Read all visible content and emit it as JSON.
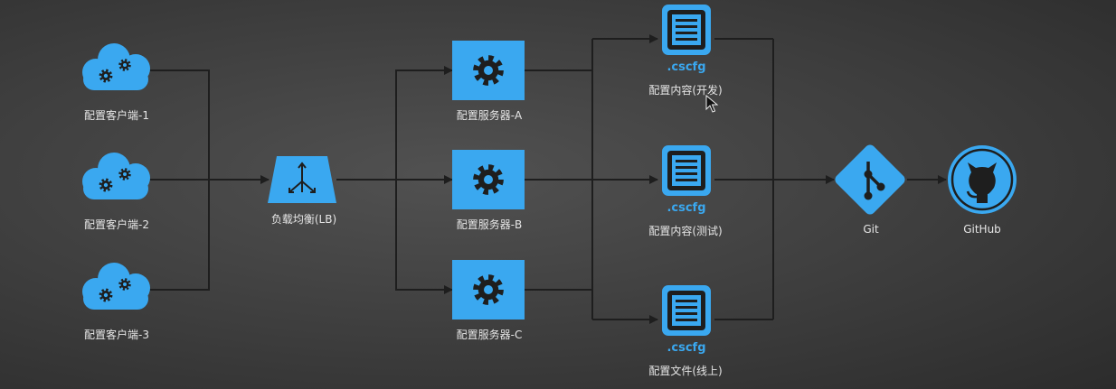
{
  "colors": {
    "accent": "#3aa8f0",
    "line": "#1e1e1e",
    "text": "#e6e6e6"
  },
  "clients": [
    {
      "label": "配置客户端-1",
      "icon": "cloud-gears-icon"
    },
    {
      "label": "配置客户端-2",
      "icon": "cloud-gears-icon"
    },
    {
      "label": "配置客户端-3",
      "icon": "cloud-gears-icon"
    }
  ],
  "load_balancer": {
    "label": "负载均衡(LB)",
    "icon": "load-balancer-icon"
  },
  "servers": [
    {
      "label": "配置服务器-A",
      "icon": "gear-icon"
    },
    {
      "label": "配置服务器-B",
      "icon": "gear-icon"
    },
    {
      "label": "配置服务器-C",
      "icon": "gear-icon"
    }
  ],
  "configs": [
    {
      "ext": ".cscfg",
      "label": "配置内容(开发)",
      "icon": "document-icon"
    },
    {
      "ext": ".cscfg",
      "label": "配置内容(测试)",
      "icon": "document-icon"
    },
    {
      "ext": ".cscfg",
      "label": "配置文件(线上)",
      "icon": "document-icon"
    }
  ],
  "git": {
    "label": "Git",
    "icon": "git-icon"
  },
  "github": {
    "label": "GitHub",
    "icon": "github-icon"
  }
}
